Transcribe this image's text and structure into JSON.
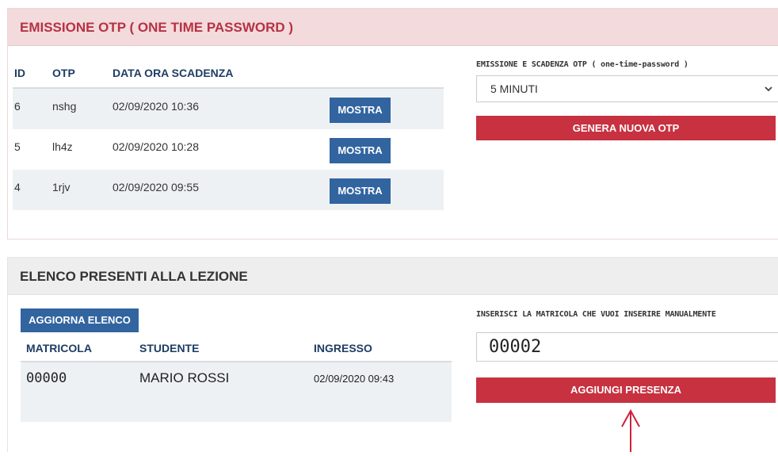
{
  "otp_panel": {
    "title": "EMISSIONE OTP ( ONE TIME PASSWORD )",
    "table": {
      "headers": {
        "id": "ID",
        "otp": "OTP",
        "expiry": "DATA ORA SCADENZA"
      },
      "rows": [
        {
          "id": "6",
          "otp": "nshg",
          "expiry": "02/09/2020 10:36",
          "action": "MOSTRA"
        },
        {
          "id": "5",
          "otp": "lh4z",
          "expiry": "02/09/2020 10:28",
          "action": "MOSTRA"
        },
        {
          "id": "4",
          "otp": "1rjv",
          "expiry": "02/09/2020 09:55",
          "action": "MOSTRA"
        }
      ]
    },
    "duration_label": "EMISSIONE E SCADENZA OTP ( one-time-password )",
    "duration_selected": "5 MINUTI",
    "generate_button": "GENERA NUOVA OTP"
  },
  "presence_panel": {
    "title": "ELENCO PRESENTI ALLA LEZIONE",
    "refresh_button": "AGGIORNA ELENCO",
    "table": {
      "headers": {
        "matricola": "MATRICOLA",
        "student": "STUDENTE",
        "entry": "INGRESSO"
      },
      "rows": [
        {
          "matricola": "00000",
          "student": "MARIO ROSSI",
          "entry": "02/09/2020 09:43"
        }
      ]
    },
    "matricola_label": "INSERISCI LA MATRICOLA CHE VUOI INSERIRE MANUALMENTE",
    "matricola_value": "00002",
    "add_button": "AGGIUNGI PRESENZA"
  },
  "colors": {
    "accent_red": "#c73140",
    "primary_blue": "#3264a0",
    "header_pink": "#f3dadc",
    "header_text_red": "#b53244",
    "annotation_arrow": "#d0213a"
  },
  "icons": {
    "select_chevron": "chevron-down-icon",
    "annotation": "arrow-up-icon"
  }
}
